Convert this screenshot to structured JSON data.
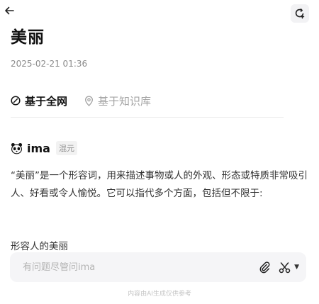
{
  "header": {
    "back_icon": "arrow-left-icon",
    "action_icon": "refresh-plus-icon"
  },
  "title": "美丽",
  "timestamp": "2025-02-21 01:36",
  "tabs": [
    {
      "label": "基于全网",
      "icon": "compass-icon",
      "active": true
    },
    {
      "label": "基于知识库",
      "icon": "location-pin-icon",
      "active": false
    }
  ],
  "source": {
    "name": "ima",
    "badge": "混元",
    "icon": "panda-icon"
  },
  "answer": {
    "paragraph": "“美丽”是一个形容词，用来描述事物或人的外观、形态或特质非常吸引人、好看或令人愉悦。它可以指代多个方面，包括但不限于:",
    "subheading": "形容人的美丽"
  },
  "input": {
    "placeholder": "有问题尽管问ima",
    "value": ""
  },
  "toolbar": {
    "attach_icon": "paperclip-icon",
    "scissors_icon": "scissors-icon",
    "dropdown_icon": "caret-down-icon"
  },
  "disclaimer": "内容由AI生成仅供参考",
  "colors": {
    "accent": "#111111",
    "muted": "#a5a5a5",
    "input_bg": "#f5f5f7"
  }
}
